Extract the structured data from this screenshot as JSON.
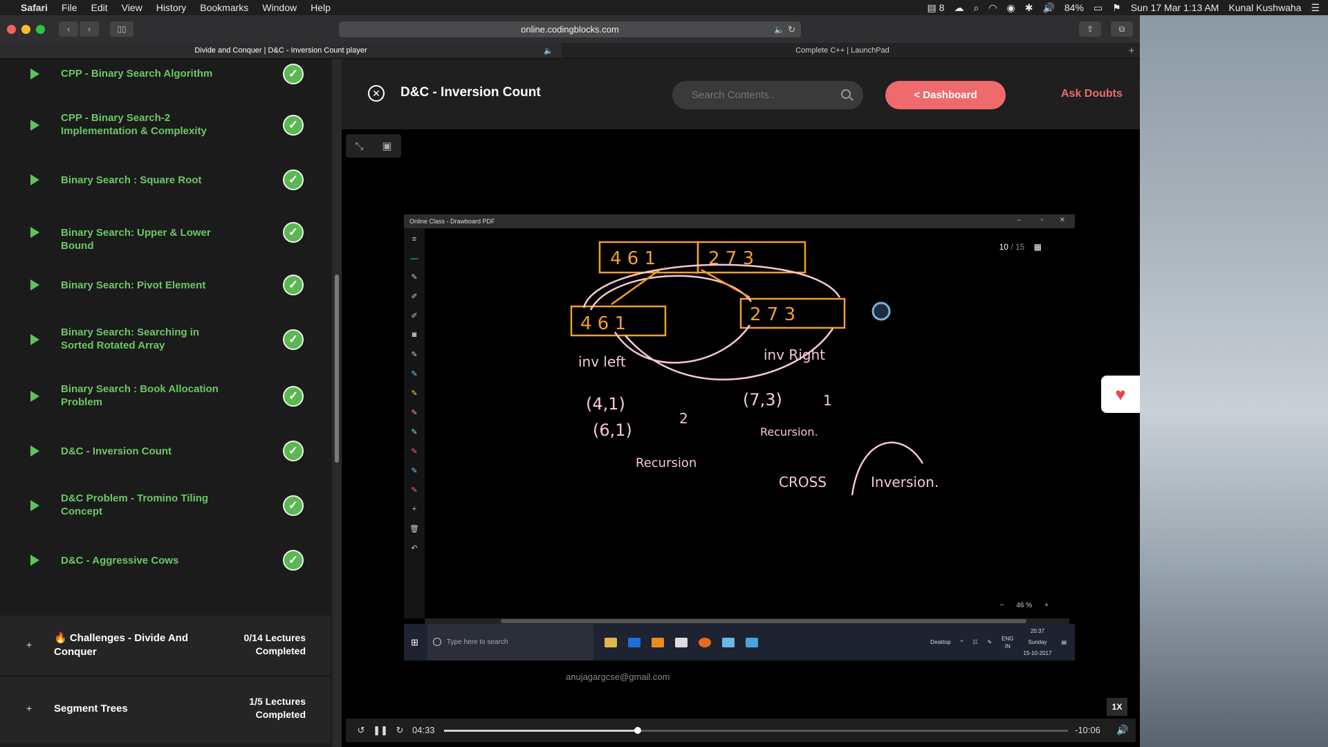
{
  "menubar": {
    "app": "Safari",
    "items": [
      "File",
      "Edit",
      "View",
      "History",
      "Bookmarks",
      "Window",
      "Help"
    ],
    "status": {
      "notif": "8",
      "battery": "84%",
      "datetime": "Sun 17 Mar  1:13 AM",
      "user": "Kunal Kushwaha"
    }
  },
  "browser": {
    "url": "online.codingblocks.com",
    "tabs": [
      {
        "label": "Divide and Conquer | D&C - Inversion Count player",
        "active": true
      },
      {
        "label": "Complete C++ | LaunchPad",
        "active": false
      }
    ]
  },
  "sidebar": {
    "lectures": [
      {
        "title": "CPP - Binary Search Algorithm"
      },
      {
        "title": "CPP - Binary Search-2 Implementation & Complexity"
      },
      {
        "title": "Binary Search : Square Root"
      },
      {
        "title": "Binary Search: Upper & Lower Bound"
      },
      {
        "title": "Binary Search: Pivot Element"
      },
      {
        "title": "Binary Search: Searching in Sorted Rotated Array"
      },
      {
        "title": "Binary Search : Book Allocation Problem"
      },
      {
        "title": "D&C - Inversion Count"
      },
      {
        "title": "D&C Problem - Tromino Tiling Concept"
      },
      {
        "title": "D&C - Aggressive Cows"
      }
    ],
    "sections": [
      {
        "title": "🔥 Challenges - Divide And Conquer",
        "count": "0/14 Lectures Completed"
      },
      {
        "title": "Segment Trees",
        "count": "1/5 Lectures Completed"
      }
    ]
  },
  "header": {
    "title": "D&C - Inversion Count",
    "search_placeholder": "Search Contents..",
    "dashboard_label": "< Dashboard",
    "ask_label": "Ask Doubts"
  },
  "video": {
    "window_title": "Online Class - Drawboard PDF",
    "page_current": "10",
    "page_total": "/ 15",
    "zoom": "46 %",
    "taskbar_search": "Type here to search",
    "tray": {
      "desktop": "Desktop",
      "lang": "ENG",
      "region": "IN",
      "time": "20:37",
      "day": "Sunday",
      "date": "15-10-2017"
    },
    "board": {
      "top_left": "4 6 1",
      "top_right": "2 7 3",
      "mid_left": "4 6 1",
      "mid_right": "2 7 3",
      "inv_left": "inv left",
      "inv_right": "inv Right",
      "pairs_left_1": "(4,1)",
      "pairs_left_2": "(6,1)",
      "count_left": "2",
      "pair_right": "(7,3)",
      "count_right": "1",
      "recursion_1": "Recursion",
      "recursion_2": "Recursion.",
      "cross": "CROSS",
      "inversion": "Inversion."
    },
    "email": "anujagargcse@gmail.com"
  },
  "player": {
    "current_time": "04:33",
    "remaining": "-10:06",
    "progress": 0.31,
    "speed": "1X"
  }
}
